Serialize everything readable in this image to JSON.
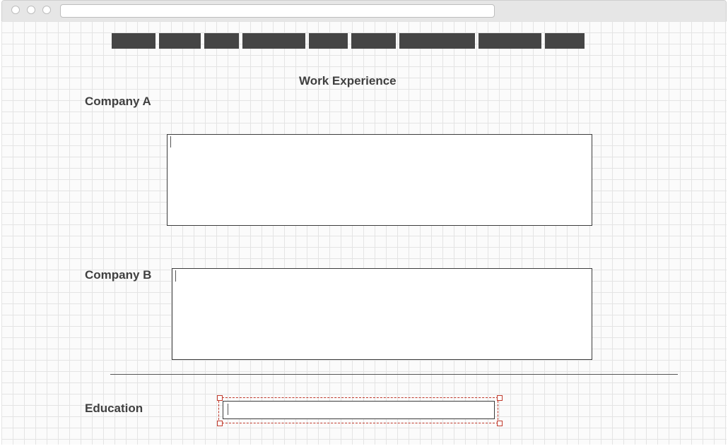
{
  "browser": {
    "address_value": ""
  },
  "nav": {
    "items": [
      {
        "label": ""
      },
      {
        "label": ""
      },
      {
        "label": ""
      },
      {
        "label": ""
      },
      {
        "label": ""
      },
      {
        "label": ""
      },
      {
        "label": ""
      },
      {
        "label": ""
      },
      {
        "label": ""
      }
    ]
  },
  "main": {
    "section_title": "Work Experience",
    "company_a_label": "Company A",
    "company_a_value": "",
    "company_b_label": "Company B",
    "company_b_value": "",
    "education_label": "Education",
    "education_value": ""
  },
  "colors": {
    "nav_bar": "#454545",
    "heading_text": "#404040",
    "selection": "#c0392b"
  }
}
